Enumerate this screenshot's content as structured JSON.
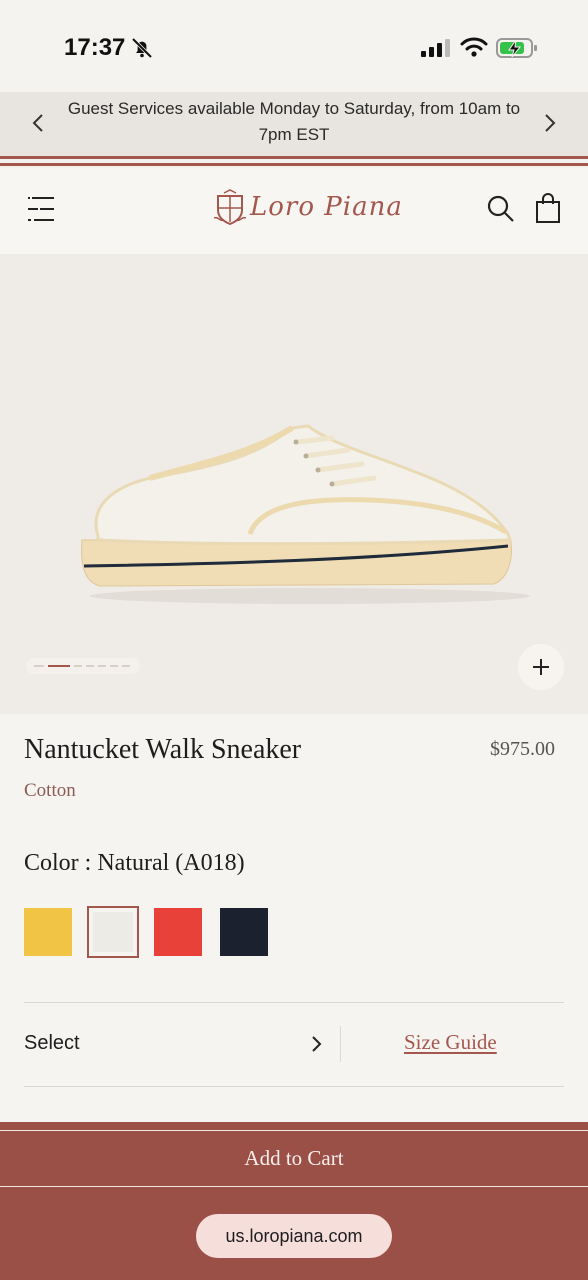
{
  "status_bar": {
    "time": "17:37",
    "icons": [
      "bell-off-icon",
      "signal-icon",
      "wifi-icon",
      "battery-charging-icon"
    ]
  },
  "announcement": {
    "text": "Guest Services available Monday to Saturday, from 10am to 7pm EST",
    "prev_icon": "chevron-left-icon",
    "next_icon": "chevron-right-icon"
  },
  "header": {
    "brand": "Loro Piana",
    "menu_icon": "menu-icon",
    "search_icon": "search-icon",
    "bag_icon": "shopping-bag-icon"
  },
  "gallery": {
    "image_count": 7,
    "active_index": 1,
    "zoom_icon": "plus-icon"
  },
  "product": {
    "name": "Nantucket Walk Sneaker",
    "price": "$975.00",
    "material": "Cotton",
    "color_label": "Color : Natural (A018)",
    "swatches": [
      {
        "name": "Yellow",
        "color": "#f2c445"
      },
      {
        "name": "Natural",
        "color": "#ecebe6",
        "selected": true
      },
      {
        "name": "Red",
        "color": "#e8413a"
      },
      {
        "name": "Navy",
        "color": "#1c2130"
      }
    ]
  },
  "size": {
    "select_label": "Select",
    "size_guide_label": "Size Guide"
  },
  "cart": {
    "add_to_cart_label": "Add to Cart"
  },
  "browser": {
    "url": "us.loropiana.com"
  },
  "colors": {
    "accent": "#a4574d",
    "cart_bg": "#9a5047",
    "page_bg": "#f6f4f1"
  }
}
